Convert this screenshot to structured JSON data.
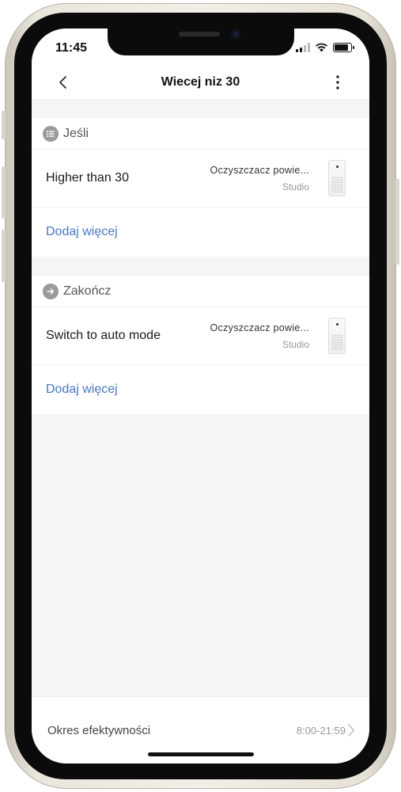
{
  "status_bar": {
    "time": "11:45",
    "battery_level": 0.85
  },
  "nav": {
    "title": "Wiecej niz 30",
    "back_icon": "chevron-left-icon",
    "more_icon": "more-vertical-icon"
  },
  "if_section": {
    "title": "Jeśli",
    "icon": "list-icon",
    "condition": {
      "label": "Higher than 30",
      "device_name": "Oczyszczacz powie...",
      "device_room": "Studio",
      "device_icon": "air-purifier-icon"
    },
    "add_more": "Dodaj więcej"
  },
  "then_section": {
    "title": "Zakończ",
    "icon": "arrow-right-icon",
    "action": {
      "label": "Switch to auto mode",
      "device_name": "Oczyszczacz powie...",
      "device_room": "Studio",
      "device_icon": "air-purifier-icon"
    },
    "add_more": "Dodaj więcej"
  },
  "effective_period": {
    "label": "Okres efektywności",
    "value": "8:00-21:59"
  },
  "colors": {
    "accent_link": "#4a78c4",
    "background": "#f5f5f5"
  }
}
